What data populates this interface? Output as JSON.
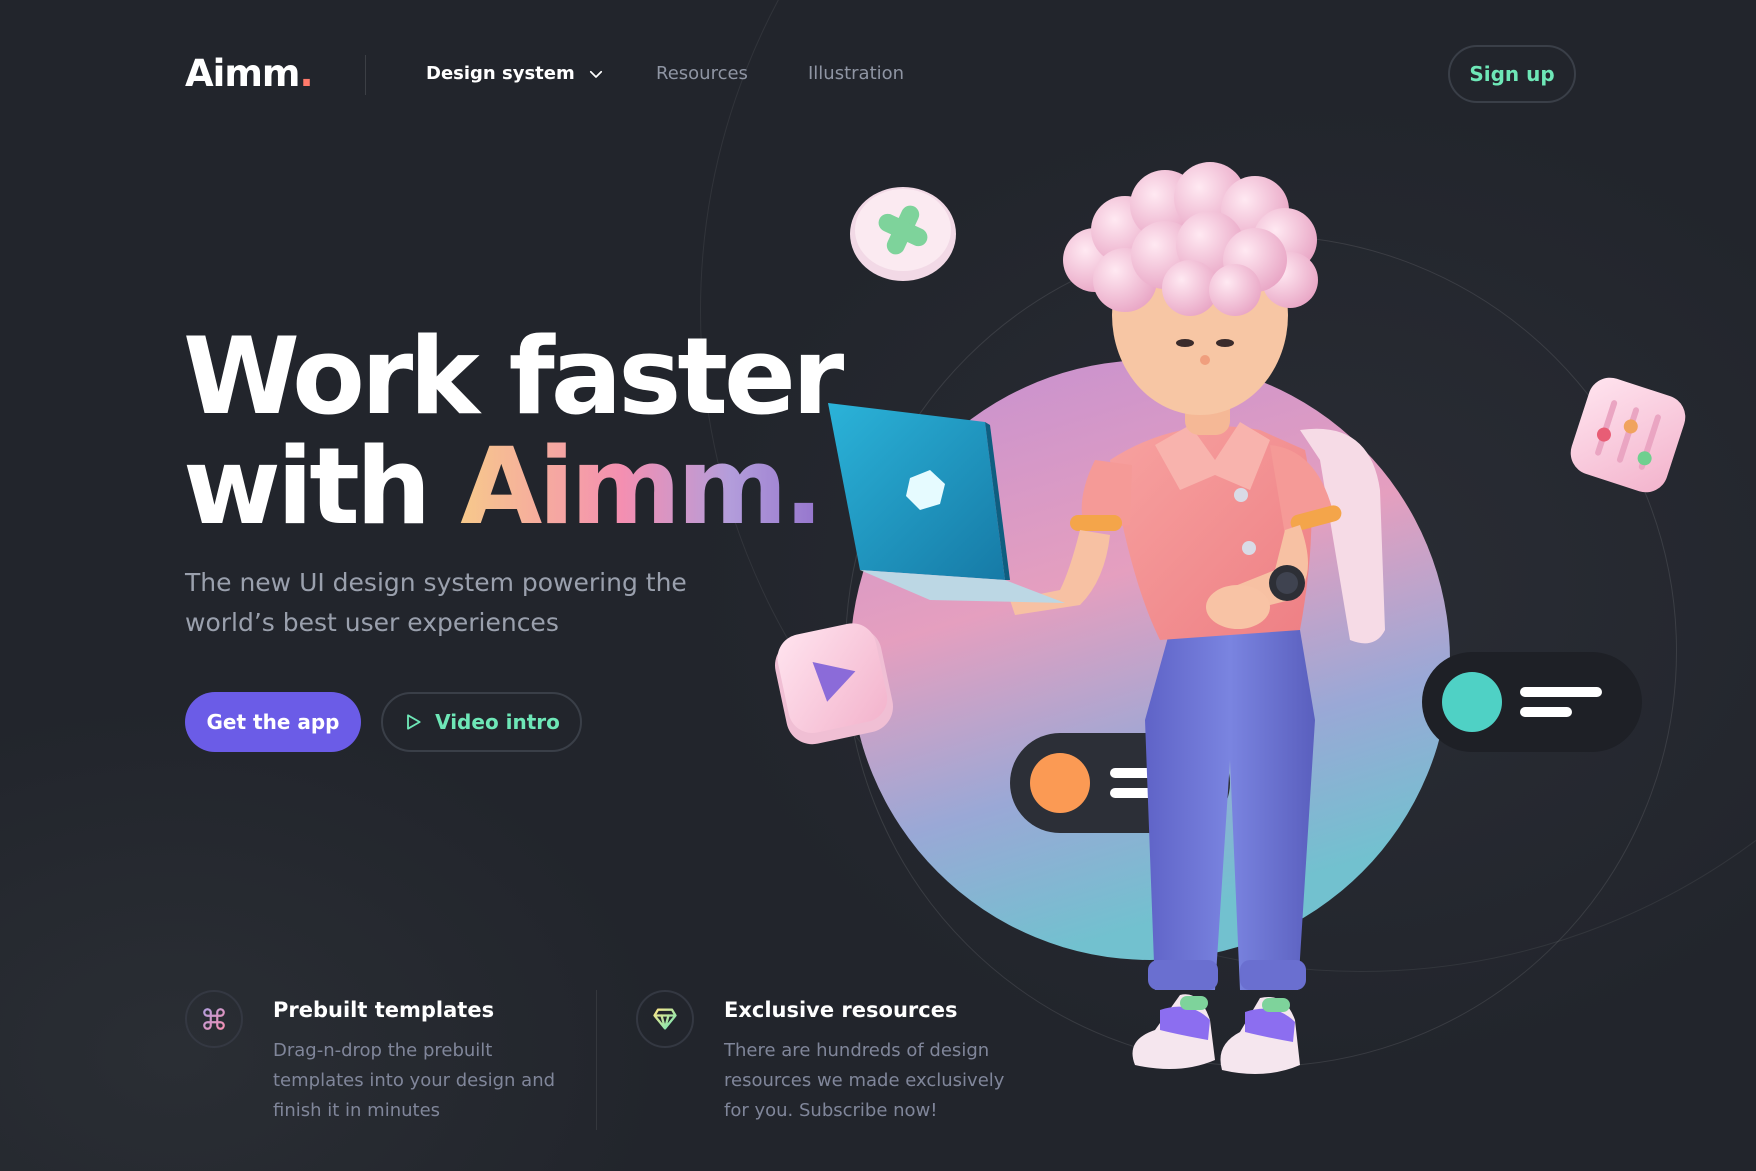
{
  "header": {
    "logo": "Aimm",
    "logo_dot": ".",
    "nav": {
      "design_system": "Design system",
      "resources": "Resources",
      "illustration": "Illustration"
    },
    "signup": "Sign up"
  },
  "hero": {
    "title_line1": "Work faster",
    "title_with": "with ",
    "title_brand": "Aimm.",
    "subtitle": "The new UI design system powering the world’s best user experiences",
    "cta_primary": "Get the app",
    "cta_secondary": "Video intro"
  },
  "features": [
    {
      "icon": "command-icon",
      "title": "Prebuilt templates",
      "desc": "Drag-n-drop the prebuilt templates into your design and finish it in minutes"
    },
    {
      "icon": "diamond-icon",
      "title": "Exclusive resources",
      "desc": "There are hundreds of design resources we made exclusively for you. Subscribe now!"
    }
  ],
  "colors": {
    "background": "#22252c",
    "accent_purple": "#6b5ce7",
    "accent_green": "#6ee7b7",
    "logo_dot": "#ff7a6b",
    "muted_text": "#9aa0ad"
  }
}
